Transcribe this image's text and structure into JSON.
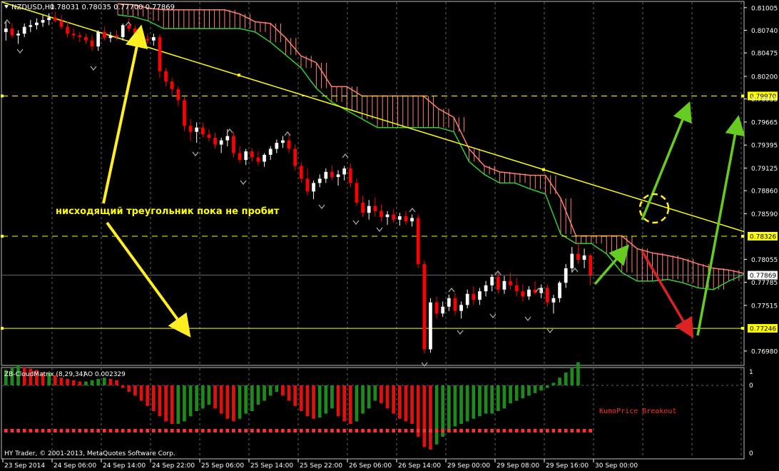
{
  "header": {
    "symbol": "NZDUSD,H1",
    "ohlc": "0.78031 0.78035 0.77700 0.77869"
  },
  "annotation": "нисходящий треугольник пока не пробит",
  "indicator": {
    "title": "ZB-CloudMatrix (8,29,34)",
    "ao": "AO 0.002329",
    "signal_label": "KumoPrice Breakout",
    "axis_labels": [
      "1",
      "0",
      "0"
    ]
  },
  "copyright": "HY Trader, © 2001-2013, MetaQuotes Software Corp.",
  "colors": {
    "background": "#000000",
    "bull": "#ffffff",
    "bear": "#ff0000",
    "cloud_top": "#ff8070",
    "cloud_bottom": "#33cc33",
    "trendline": "#ffff00",
    "level": "#ffff00",
    "ao_up": "#1e8a1e",
    "ao_down": "#e01010",
    "signal": "#ff3030",
    "grid": "#bbbbbb",
    "arrow_up": "#66cc22",
    "arrow_down": "#dd2222",
    "arrow_yellow": "#ffee22"
  },
  "chart_data": {
    "type": "candlestick",
    "price_ticks": [
      "0.81005",
      "0.80740",
      "0.80475",
      "0.80200",
      "0.79935",
      "0.79665",
      "0.79395",
      "0.79125",
      "0.78860",
      "0.78590",
      "0.78055",
      "0.77785",
      "0.77515",
      "0.76980"
    ],
    "ylim": [
      0.7682,
      0.8107
    ],
    "levels": [
      {
        "value": 0.7997,
        "label": "0.79970",
        "style": "dashed"
      },
      {
        "value": 0.78326,
        "label": "0.78326",
        "style": "dashed"
      },
      {
        "value": 0.77246,
        "label": "0.77246",
        "style": "solid"
      }
    ],
    "current_price": {
      "value": 0.77869,
      "label": "0.77869"
    },
    "time_labels": [
      "23 Sep 2014",
      "24 Sep 06:00",
      "24 Sep 14:00",
      "24 Sep 22:00",
      "25 Sep 06:00",
      "25 Sep 14:00",
      "25 Sep 22:00",
      "26 Sep 06:00",
      "26 Sep 14:00",
      "29 Sep 00:00",
      "29 Sep 08:00",
      "29 Sep 16:00",
      "30 Sep 00:00"
    ],
    "candles": [
      [
        0.8072,
        0.8085,
        0.8062,
        0.8076
      ],
      [
        0.8076,
        0.8082,
        0.8065,
        0.8068
      ],
      [
        0.8068,
        0.8074,
        0.8058,
        0.807
      ],
      [
        0.807,
        0.8082,
        0.8066,
        0.8078
      ],
      [
        0.8078,
        0.8086,
        0.8072,
        0.808
      ],
      [
        0.808,
        0.8088,
        0.8075,
        0.8083
      ],
      [
        0.8083,
        0.8092,
        0.8078,
        0.8086
      ],
      [
        0.8086,
        0.8094,
        0.808,
        0.8089
      ],
      [
        0.8089,
        0.8096,
        0.8083,
        0.8085
      ],
      [
        0.8085,
        0.8092,
        0.8075,
        0.8078
      ],
      [
        0.8078,
        0.8084,
        0.8066,
        0.807
      ],
      [
        0.807,
        0.8076,
        0.8064,
        0.8068
      ],
      [
        0.8068,
        0.8072,
        0.806,
        0.8066
      ],
      [
        0.8066,
        0.807,
        0.8058,
        0.8062
      ],
      [
        0.8062,
        0.8068,
        0.805,
        0.8055
      ],
      [
        0.8055,
        0.8074,
        0.805,
        0.8072
      ],
      [
        0.8072,
        0.8078,
        0.8062,
        0.8065
      ],
      [
        0.8065,
        0.8072,
        0.806,
        0.8068
      ],
      [
        0.8068,
        0.8074,
        0.8062,
        0.8066
      ],
      [
        0.8066,
        0.8082,
        0.8062,
        0.808
      ],
      [
        0.808,
        0.8088,
        0.8072,
        0.8076
      ],
      [
        0.8076,
        0.808,
        0.8066,
        0.807
      ],
      [
        0.807,
        0.8076,
        0.806,
        0.8064
      ],
      [
        0.8064,
        0.807,
        0.8058,
        0.8062
      ],
      [
        0.8062,
        0.807,
        0.8056,
        0.8066
      ],
      [
        0.8066,
        0.8069,
        0.8018,
        0.8026
      ],
      [
        0.8026,
        0.803,
        0.8008,
        0.8014
      ],
      [
        0.8014,
        0.8018,
        0.7998,
        0.8005
      ],
      [
        0.8005,
        0.8008,
        0.7985,
        0.7992
      ],
      [
        0.7992,
        0.7996,
        0.7956,
        0.7962
      ],
      [
        0.7962,
        0.797,
        0.7944,
        0.7955
      ],
      [
        0.7955,
        0.7966,
        0.7942,
        0.796
      ],
      [
        0.796,
        0.7966,
        0.7948,
        0.7952
      ],
      [
        0.7952,
        0.7958,
        0.7944,
        0.7948
      ],
      [
        0.7948,
        0.7954,
        0.7935,
        0.794
      ],
      [
        0.794,
        0.7948,
        0.793,
        0.7945
      ],
      [
        0.7945,
        0.7958,
        0.7938,
        0.795
      ],
      [
        0.795,
        0.7955,
        0.7925,
        0.793
      ],
      [
        0.793,
        0.7938,
        0.7918,
        0.7922
      ],
      [
        0.7922,
        0.7935,
        0.7916,
        0.7932
      ],
      [
        0.7932,
        0.7936,
        0.792,
        0.7925
      ],
      [
        0.7925,
        0.7932,
        0.7915,
        0.792
      ],
      [
        0.792,
        0.793,
        0.7914,
        0.7928
      ],
      [
        0.7928,
        0.7938,
        0.7922,
        0.7935
      ],
      [
        0.7935,
        0.7946,
        0.793,
        0.7942
      ],
      [
        0.7942,
        0.795,
        0.7936,
        0.7945
      ],
      [
        0.7945,
        0.7952,
        0.793,
        0.7935
      ],
      [
        0.7935,
        0.794,
        0.791,
        0.7915
      ],
      [
        0.7915,
        0.792,
        0.7895,
        0.79
      ],
      [
        0.79,
        0.7912,
        0.788,
        0.7885
      ],
      [
        0.7885,
        0.7898,
        0.7876,
        0.7895
      ],
      [
        0.7895,
        0.7905,
        0.789,
        0.79
      ],
      [
        0.79,
        0.7912,
        0.7895,
        0.7908
      ],
      [
        0.7908,
        0.7915,
        0.7898,
        0.7902
      ],
      [
        0.7902,
        0.791,
        0.7892,
        0.7905
      ],
      [
        0.7905,
        0.7915,
        0.7898,
        0.7912
      ],
      [
        0.7912,
        0.7918,
        0.789,
        0.7895
      ],
      [
        0.7895,
        0.79,
        0.7868,
        0.7872
      ],
      [
        0.7872,
        0.788,
        0.7855,
        0.786
      ],
      [
        0.786,
        0.7875,
        0.7852,
        0.7868
      ],
      [
        0.7868,
        0.7878,
        0.7856,
        0.7862
      ],
      [
        0.7862,
        0.787,
        0.785,
        0.7855
      ],
      [
        0.7855,
        0.7862,
        0.7846,
        0.7858
      ],
      [
        0.7858,
        0.7864,
        0.7848,
        0.7852
      ],
      [
        0.7852,
        0.786,
        0.7845,
        0.7856
      ],
      [
        0.7856,
        0.7862,
        0.7846,
        0.785
      ],
      [
        0.785,
        0.7858,
        0.7844,
        0.7854
      ],
      [
        0.7854,
        0.7858,
        0.7795,
        0.78
      ],
      [
        0.78,
        0.7804,
        0.7695,
        0.77
      ],
      [
        0.77,
        0.776,
        0.7696,
        0.7755
      ],
      [
        0.7755,
        0.7762,
        0.7736,
        0.7742
      ],
      [
        0.7742,
        0.7756,
        0.7738,
        0.775
      ],
      [
        0.775,
        0.7764,
        0.7745,
        0.776
      ],
      [
        0.776,
        0.7766,
        0.774,
        0.7745
      ],
      [
        0.7745,
        0.7756,
        0.7736,
        0.7752
      ],
      [
        0.7752,
        0.777,
        0.7748,
        0.7765
      ],
      [
        0.7765,
        0.7774,
        0.7752,
        0.7758
      ],
      [
        0.7758,
        0.7772,
        0.7752,
        0.7768
      ],
      [
        0.7768,
        0.778,
        0.7762,
        0.7775
      ],
      [
        0.7775,
        0.7788,
        0.7768,
        0.7785
      ],
      [
        0.7785,
        0.779,
        0.7765,
        0.777
      ],
      [
        0.777,
        0.7786,
        0.7765,
        0.778
      ],
      [
        0.778,
        0.779,
        0.777,
        0.7775
      ],
      [
        0.7775,
        0.7784,
        0.7762,
        0.7768
      ],
      [
        0.7768,
        0.7776,
        0.7756,
        0.7762
      ],
      [
        0.7762,
        0.7774,
        0.7758,
        0.777
      ],
      [
        0.777,
        0.778,
        0.7764,
        0.7766
      ],
      [
        0.7766,
        0.7776,
        0.776,
        0.7772
      ],
      [
        0.7772,
        0.7776,
        0.775,
        0.7755
      ],
      [
        0.7755,
        0.7764,
        0.7742,
        0.776
      ],
      [
        0.776,
        0.778,
        0.7755,
        0.7778
      ],
      [
        0.7778,
        0.78,
        0.7772,
        0.7795
      ],
      [
        0.7795,
        0.782,
        0.779,
        0.7812
      ],
      [
        0.7812,
        0.7826,
        0.78,
        0.7805
      ],
      [
        0.7805,
        0.7818,
        0.7795,
        0.781
      ],
      [
        0.781,
        0.7812,
        0.7775,
        0.7787
      ]
    ],
    "cloud_top": [
      0.8105,
      0.8104,
      0.81,
      0.8098,
      0.8098,
      0.8098,
      0.8098,
      0.8098,
      0.8093,
      0.8084,
      0.8082,
      0.8065,
      0.8044,
      0.8036,
      0.8008,
      0.8008,
      0.7997,
      0.7997,
      0.7997,
      0.7997,
      0.7997,
      0.7982,
      0.7972,
      0.7935,
      0.7915,
      0.7908,
      0.7906,
      0.7904,
      0.7904,
      0.7877,
      0.7833,
      0.7833,
      0.7833,
      0.7833,
      0.7818,
      0.7813,
      0.781,
      0.7806,
      0.78,
      0.7795,
      0.7793,
      0.7789
    ],
    "cloud_bottom": [
      0.8092,
      0.809,
      0.8085,
      0.8076,
      0.8076,
      0.8076,
      0.8076,
      0.8076,
      0.8076,
      0.8072,
      0.806,
      0.8045,
      0.803,
      0.8006,
      0.799,
      0.798,
      0.797,
      0.796,
      0.796,
      0.796,
      0.796,
      0.796,
      0.7955,
      0.792,
      0.7905,
      0.7895,
      0.7895,
      0.7888,
      0.7882,
      0.7835,
      0.7824,
      0.7824,
      0.7812,
      0.779,
      0.778,
      0.778,
      0.7782,
      0.7778,
      0.7772,
      0.777,
      0.778,
      0.7788
    ],
    "trendline": [
      [
        0.8107,
        0.7838
      ]
    ],
    "ao": [
      12,
      14,
      16,
      14,
      13,
      12,
      10,
      10,
      8,
      6,
      5,
      4,
      3,
      3,
      4,
      5,
      6,
      5,
      4,
      -2,
      -5,
      -8,
      -12,
      -16,
      -20,
      -24,
      -28,
      -30,
      -30,
      -28,
      -24,
      -20,
      -18,
      -15,
      -18,
      -22,
      -26,
      -28,
      -26,
      -22,
      -20,
      -15,
      -12,
      -8,
      -5,
      -8,
      -12,
      -16,
      -20,
      -24,
      -26,
      -25,
      -22,
      -18,
      -24,
      -28,
      -30,
      -28,
      -22,
      -18,
      -12,
      -14,
      -18,
      -22,
      -26,
      -28,
      -30,
      -40,
      -48,
      -50,
      -46,
      -40,
      -36,
      -32,
      -30,
      -28,
      -26,
      -24,
      -22,
      -22,
      -20,
      -18,
      -14,
      -12,
      -10,
      -8,
      -6,
      -4,
      -2,
      2,
      6,
      10,
      14,
      18
    ]
  }
}
